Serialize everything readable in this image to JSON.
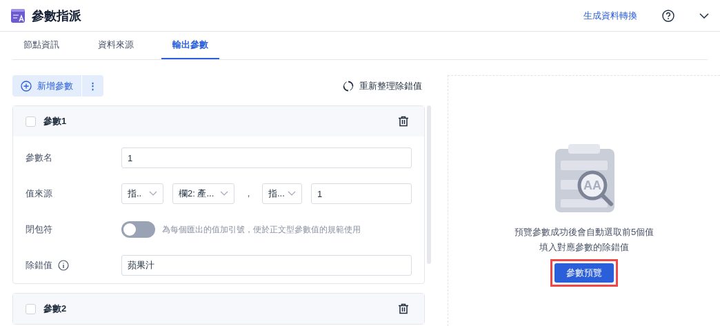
{
  "header": {
    "title": "參數指派",
    "link": "生成資料轉換"
  },
  "tabs": [
    {
      "label": "節點資訊",
      "selected": false
    },
    {
      "label": "資料來源",
      "selected": false
    },
    {
      "label": "輸出參數",
      "selected": true
    }
  ],
  "toolbar": {
    "add_button": "新增參數",
    "more_button": "⋮",
    "refresh_button": "重新整理除錯值"
  },
  "params": [
    {
      "title": "參數1",
      "checked": false,
      "rows": [
        {
          "kind": "input",
          "label": "參數名",
          "value": "1"
        },
        {
          "kind": "sources",
          "label": "值來源",
          "selects": [
            "指..",
            "欄2: 產...",
            "指..."
          ],
          "separator": "，",
          "value": "1"
        },
        {
          "kind": "toggle",
          "label": "閉包符",
          "on": false,
          "hint": "為每個匯出的值加引號，便於正文型參數值的規範使用"
        },
        {
          "kind": "input",
          "label": "除錯值",
          "info": true,
          "value": "蘋果汁"
        }
      ]
    },
    {
      "title": "參數2",
      "checked": false
    }
  ],
  "preview": {
    "illustration_text": "AA",
    "message": [
      "預覽參數成功後會自動選取前5個值",
      "填入對應參數的除錯值"
    ],
    "button": "參數預覽",
    "highlighted": true
  }
}
